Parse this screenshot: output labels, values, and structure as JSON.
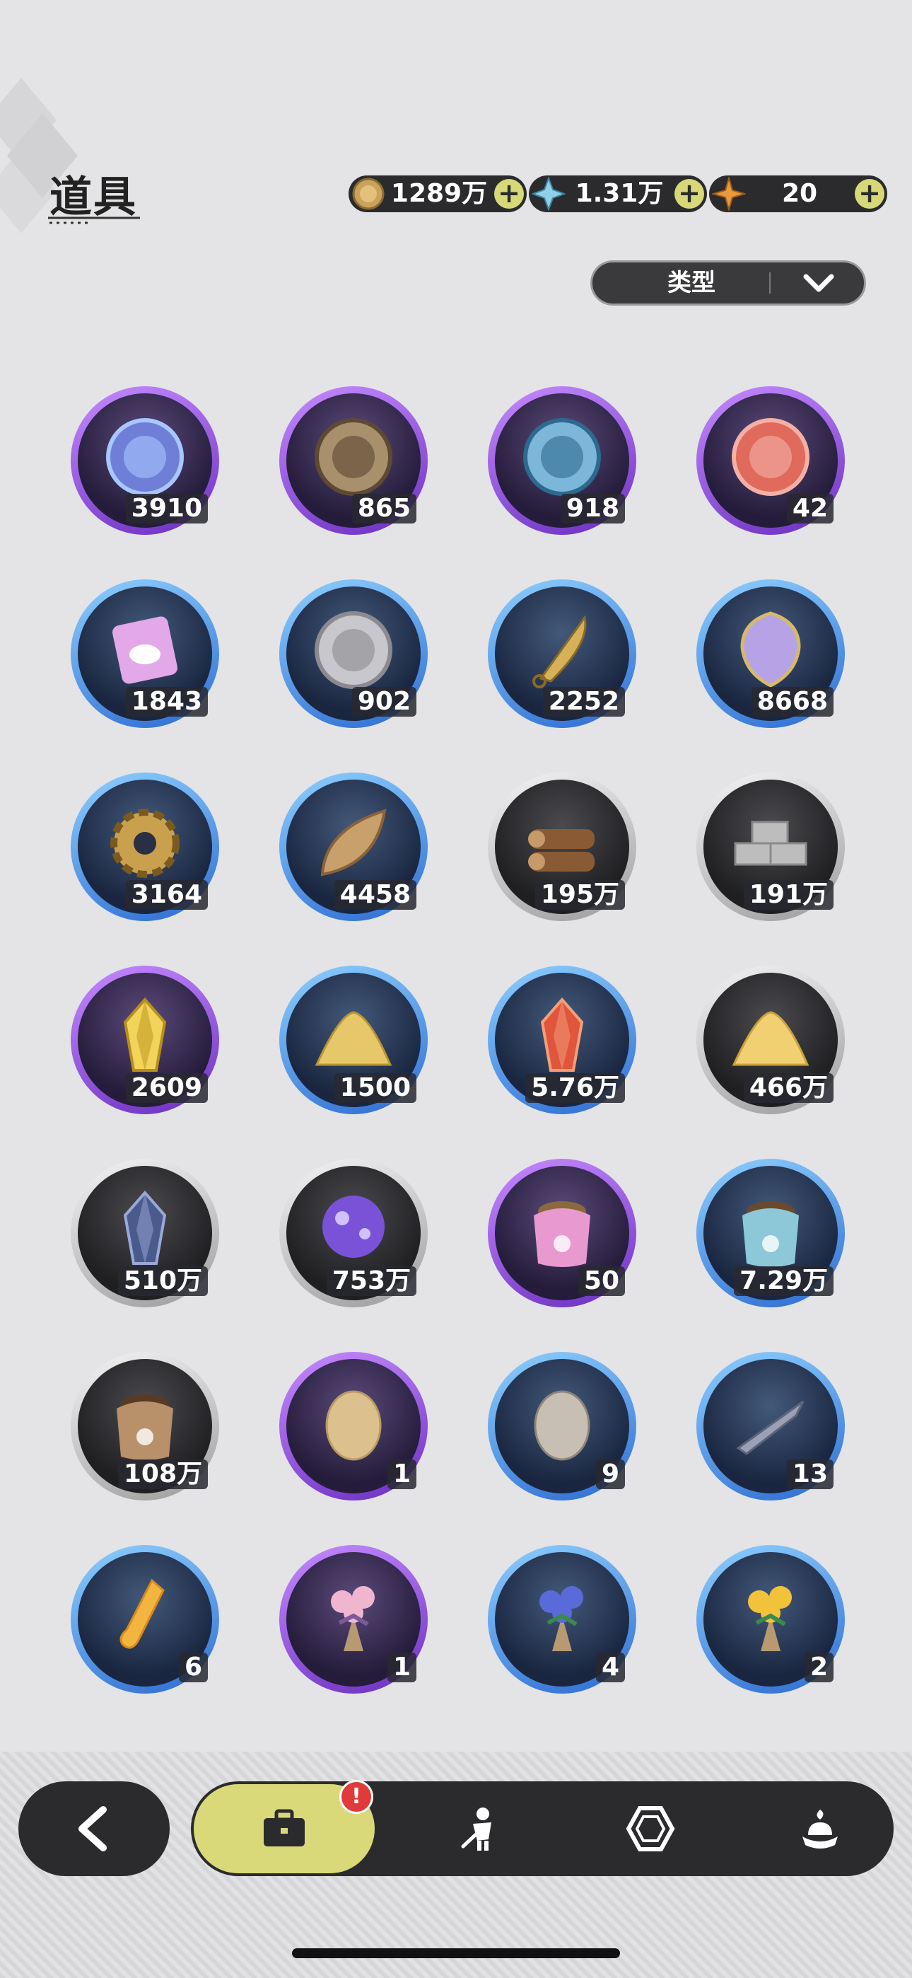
{
  "header": {
    "title": "道具",
    "filter_label": "类型"
  },
  "currencies": [
    {
      "name": "gold-coin",
      "value": "1289万",
      "color": "#c9a25c"
    },
    {
      "name": "crystal",
      "value": "1.31万",
      "color": "#8fd0e8"
    },
    {
      "name": "star-gem",
      "value": "20",
      "color": "#e89a3c"
    }
  ],
  "items": [
    {
      "count": "3910",
      "rarity": "purple",
      "icon": "star-moon-coin-icon"
    },
    {
      "count": "865",
      "rarity": "purple",
      "icon": "fist-coin-icon"
    },
    {
      "count": "918",
      "rarity": "purple",
      "icon": "shield-coin-icon"
    },
    {
      "count": "42",
      "rarity": "purple",
      "icon": "heart-coin-icon"
    },
    {
      "count": "1843",
      "rarity": "blue",
      "icon": "bunny-card-icon"
    },
    {
      "count": "902",
      "rarity": "blue",
      "icon": "silver-coin-icon"
    },
    {
      "count": "2252",
      "rarity": "blue",
      "icon": "blade-icon"
    },
    {
      "count": "8668",
      "rarity": "blue",
      "icon": "scale-shield-icon"
    },
    {
      "count": "3164",
      "rarity": "blue",
      "icon": "gear-icon"
    },
    {
      "count": "4458",
      "rarity": "blue",
      "icon": "leaf-icon"
    },
    {
      "count": "195万",
      "rarity": "gray",
      "icon": "wood-logs-icon"
    },
    {
      "count": "191万",
      "rarity": "gray",
      "icon": "stone-bricks-icon"
    },
    {
      "count": "2609",
      "rarity": "purple",
      "icon": "gold-crystal-icon"
    },
    {
      "count": "1500",
      "rarity": "blue",
      "icon": "gold-dust-icon"
    },
    {
      "count": "5.76万",
      "rarity": "blue",
      "icon": "red-crystal-icon"
    },
    {
      "count": "466万",
      "rarity": "gray",
      "icon": "sand-pile-icon"
    },
    {
      "count": "510万",
      "rarity": "gray",
      "icon": "dark-crystal-icon"
    },
    {
      "count": "753万",
      "rarity": "gray",
      "icon": "purple-orb-icon"
    },
    {
      "count": "50",
      "rarity": "purple",
      "icon": "pink-feed-bag-icon"
    },
    {
      "count": "7.29万",
      "rarity": "blue",
      "icon": "blue-feed-bag-icon"
    },
    {
      "count": "108万",
      "rarity": "gray",
      "icon": "brown-feed-bag-icon"
    },
    {
      "count": "1",
      "rarity": "purple",
      "icon": "egg-icon"
    },
    {
      "count": "9",
      "rarity": "blue",
      "icon": "stone-egg-icon"
    },
    {
      "count": "13",
      "rarity": "blue",
      "icon": "herb-bundle-icon"
    },
    {
      "count": "6",
      "rarity": "blue",
      "icon": "potion-vial-icon"
    },
    {
      "count": "1",
      "rarity": "purple",
      "icon": "pink-bouquet-icon"
    },
    {
      "count": "4",
      "rarity": "blue",
      "icon": "blue-bouquet-icon"
    },
    {
      "count": "2",
      "rarity": "blue",
      "icon": "yellow-bouquet-icon"
    }
  ],
  "nav": {
    "badge": "!",
    "tabs": [
      "briefcase-icon",
      "character-icon",
      "gem-icon",
      "dessert-icon"
    ]
  }
}
